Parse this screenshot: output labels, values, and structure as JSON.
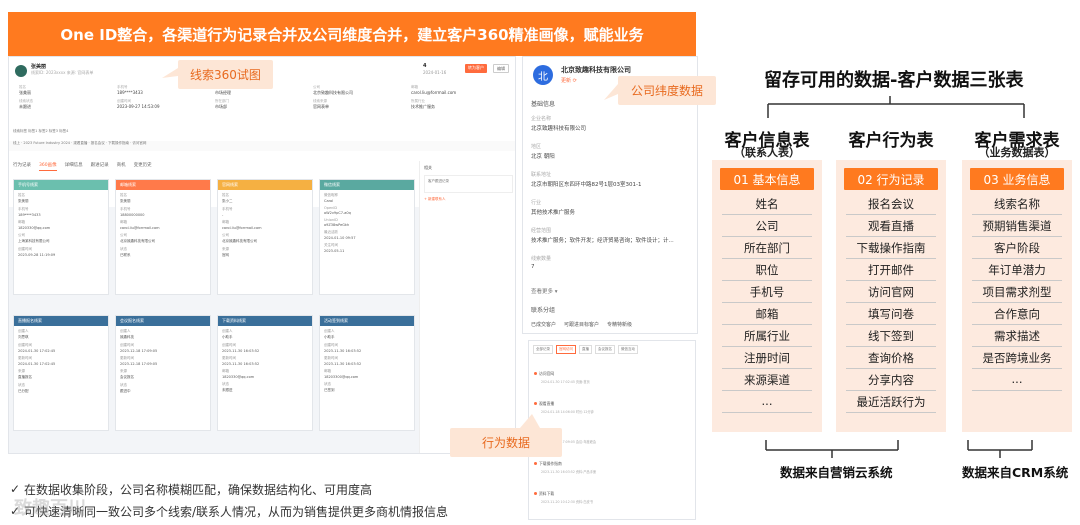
{
  "banner": {
    "title": "One ID整合，各渠道行为记录合并及公司维度合并，建立客户360精准画像，赋能业务"
  },
  "crm": {
    "lead_name": "张美丽",
    "lead_sub": "线索ID: 2023xxxx  来源: 官网表单",
    "kpi_value": "4",
    "kpi_sub": "2024-01-16",
    "btn_primary": "转为客户",
    "btn_default": "编辑",
    "fields": [
      {
        "label": "姓名",
        "value": "张美丽"
      },
      {
        "label": "手机号",
        "value": "189****3433"
      },
      {
        "label": "职位",
        "value": "市场经理"
      },
      {
        "label": "公司",
        "value": "北京致趣科技有限公司"
      },
      {
        "label": "邮箱",
        "value": "carol.liu@forrmail.com"
      },
      {
        "label": "线索状态",
        "value": "未跟进"
      },
      {
        "label": "创建时间",
        "value": "2023-09-27 14:53:09"
      },
      {
        "label": "所在部门",
        "value": "市场部"
      },
      {
        "label": "线索来源",
        "value": "官网表单"
      },
      {
        "label": "所属行业",
        "value": "技术推广服务"
      }
    ],
    "tags_row": "线索标签  标签1  标签2  标签3  标签4",
    "record_row": "线上 · 2023 Future Industry 2024 · 观看直播 · 报名会议 · 下载操作指南 · 访问官网",
    "tabs": [
      "行为记录",
      "360画像",
      "详细信息",
      "跟进记录",
      "商机",
      "变更历史"
    ],
    "cards": [
      {
        "title": "手机号线索",
        "color": "#6bbfae",
        "lines": [
          "姓名",
          "张美丽",
          "手机号",
          "189****3433",
          "邮箱",
          "1820330@qq.com",
          "公司",
          "上海某科技有限公司",
          "创建时间",
          "2023-09-28 11:19:09"
        ]
      },
      {
        "title": "邮箱线索",
        "color": "#ff7a4a",
        "lines": [
          "姓名",
          "张美丽",
          "手机号",
          "18800000000",
          "邮箱",
          "carol.liu@forrmail.com",
          "公司",
          "北京致趣科技有限公司",
          "状态",
          "已联系"
        ]
      },
      {
        "title": "官网线索",
        "color": "#f5b042",
        "lines": [
          "姓名",
          "张小二",
          "手机号",
          "-",
          "邮箱",
          "carol.liu@forrmail.com",
          "公司",
          "北京致趣科技有限公司",
          "来源",
          "官网"
        ]
      },
      {
        "title": "微信线索",
        "color": "#5aa9a0",
        "lines": [
          "微信昵称",
          "Carol",
          "OpenID",
          "oW2v9pC7-a0q",
          "UnionID",
          "o9Z38wPeGkh",
          "最近活跃",
          "2024-01-10 09:57",
          "关注时间",
          "2023-05-11"
        ]
      },
      {
        "title": "直播报名线索",
        "color": "#3a6f9a",
        "lines": [
          "创建人",
          "刘思琪",
          "创建时间",
          "2024-01-30 17:02:45",
          "更新时间",
          "2024-01-30 17:02:45",
          "来源",
          "直播报名",
          "状态",
          "已分配"
        ]
      },
      {
        "title": "会议报名线索",
        "color": "#3a6f9a",
        "lines": [
          "创建人",
          "致趣科技",
          "创建时间",
          "2023-12-18 17:09:05",
          "更新时间",
          "2023-12-18 17:09:05",
          "来源",
          "会议报名",
          "状态",
          "跟进中"
        ]
      },
      {
        "title": "下载资料线索",
        "color": "#3a6f9a",
        "lines": [
          "创建人",
          "小助手",
          "创建时间",
          "2023-11-30 16:03:52",
          "更新时间",
          "2023-11-30 16:03:52",
          "邮箱",
          "1820330@qq.com",
          "状态",
          "未跟进"
        ]
      },
      {
        "title": "活动签到线索",
        "color": "#3a6f9a",
        "lines": [
          "创建人",
          "小助手",
          "创建时间",
          "2023-11-30 16:03:52",
          "更新时间",
          "2023-11-30 16:03:52",
          "邮箱",
          "18203300@qq.com",
          "状态",
          "已签到"
        ]
      }
    ],
    "side_title": "相关",
    "side_box": "客户跟进记录",
    "side_link": "+ 新建联系人"
  },
  "company": {
    "logo": "北",
    "name": "北京致趣科技有限公司",
    "update": "更新 ⟳",
    "section": "基础信息",
    "rows": [
      {
        "label": "企业名称",
        "value": "北京致趣科技有限公司"
      },
      {
        "label": "地区",
        "value": "北京 朝阳"
      },
      {
        "label": "联系地址",
        "value": "北京市朝阳区东四环中路82号1层03室301-1"
      },
      {
        "label": "行业",
        "value": "其他技术推广服务"
      },
      {
        "label": "经营范围",
        "value": "技术推广服务；软件开发；经济贸易咨询；软件设计；计..."
      },
      {
        "label": "线索数量",
        "value": "7"
      }
    ],
    "more": "查看更多 ▾",
    "section2": "联系分组",
    "btns": [
      "已成交客户",
      "可跟进目标客户",
      "专精特新级"
    ]
  },
  "timeline": {
    "tabs": [
      "全部记录",
      "官网访问",
      "直播",
      "会议报名",
      "微信互动"
    ],
    "items": [
      {
        "title": "访问官网",
        "sub": "2024-01-30 17:02:45  页面:首页"
      },
      {
        "title": "观看直播",
        "sub": "2024-01-18 14:06:00  时长:12分钟"
      },
      {
        "title": "报名会议",
        "sub": "2023-12-18 17:09:05  会议:年度峰会"
      },
      {
        "title": "下载操作指南",
        "sub": "2023-11-30 16:03:52  资料:产品手册"
      },
      {
        "title": "资料下载",
        "sub": "2023-11-20 10:12:30  资料:白皮书"
      }
    ]
  },
  "callouts": {
    "lead360": "线索360试图",
    "company_dim": "公司纬度数据",
    "behavior": "行为数据"
  },
  "bullets": [
    "在数据收集阶段，公司名称模糊匹配，确保数据结构化、可用度高",
    "可快速清晰同一致公司多个线索/联系人情况，从而为销售提供更多商机情报信息"
  ],
  "watermark": "致趣百川",
  "right": {
    "title": "留存可用的数据-客户数据三张表",
    "tables": [
      {
        "title": "客户信息表",
        "sub": "（联系人表）",
        "head": "01 基本信息",
        "items": [
          "姓名",
          "公司",
          "所在部门",
          "职位",
          "手机号",
          "邮箱",
          "所属行业",
          "注册时间",
          "来源渠道",
          "..."
        ]
      },
      {
        "title": "客户行为表",
        "sub": "",
        "head": "02 行为记录",
        "items": [
          "报名会议",
          "观看直播",
          "下载操作指南",
          "打开邮件",
          "访问官网",
          "填写问卷",
          "线下签到",
          "查询价格",
          "分享内容",
          "最近活跃行为"
        ]
      },
      {
        "title": "客户需求表",
        "sub": "（业务数据表）",
        "head": "03 业务信息",
        "items": [
          "线索名称",
          "预期销售渠道",
          "客户阶段",
          "年订单潜力",
          "项目需求剂型",
          "合作意向",
          "需求描述",
          "是否跨境业务",
          "..."
        ]
      }
    ],
    "source_left": "数据来自营销云系统",
    "source_right": "数据来自CRM系统"
  }
}
